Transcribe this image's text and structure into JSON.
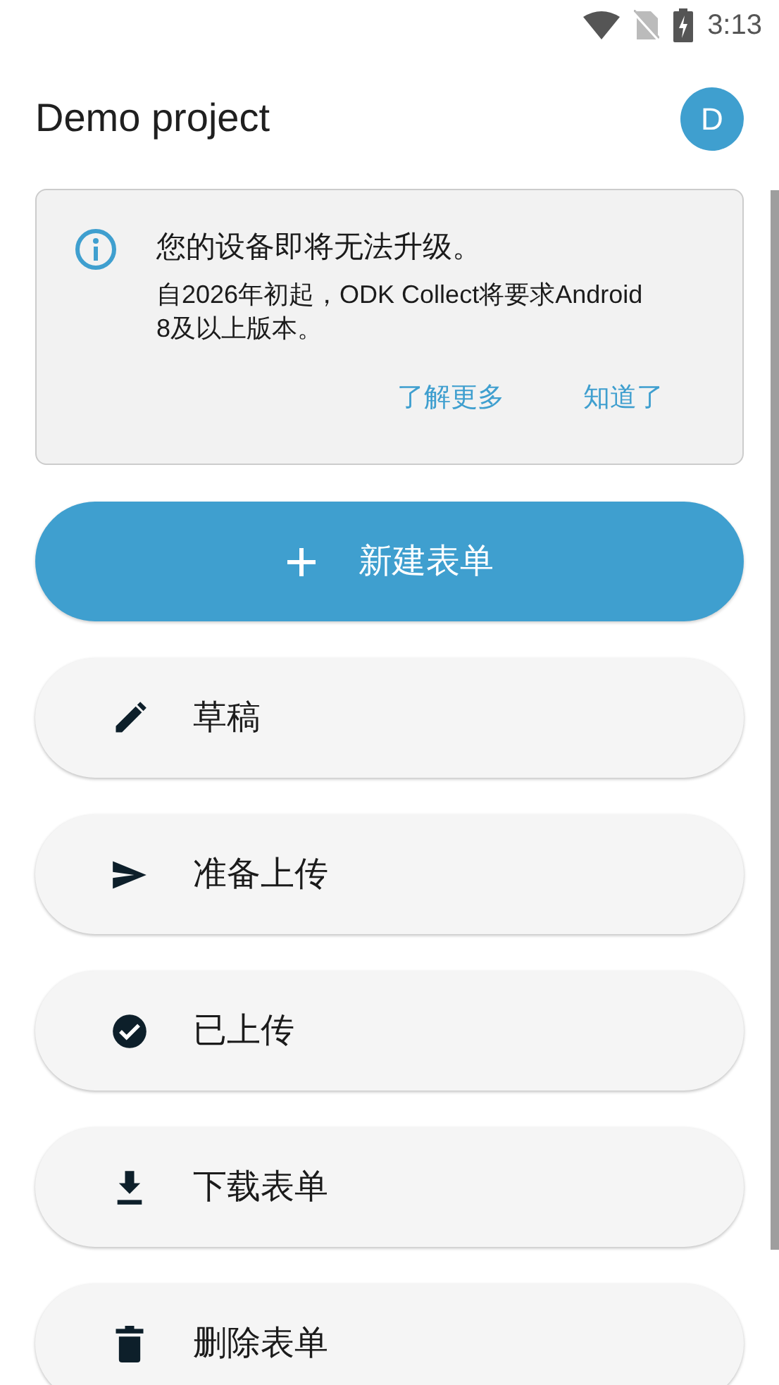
{
  "status_bar": {
    "time": "3:13"
  },
  "header": {
    "title": "Demo project",
    "avatar": "D"
  },
  "banner": {
    "title": "您的设备即将无法升级。",
    "message": "自2026年初起，ODK Collect将要求Android 8及以上版本。",
    "actions": [
      "了解更多",
      "知道了"
    ]
  },
  "primary_button": {
    "label": "新建表单"
  },
  "menu": [
    {
      "kind": "edit",
      "label": "草稿"
    },
    {
      "kind": "send",
      "label": "准备上传"
    },
    {
      "kind": "done",
      "label": "已上传"
    },
    {
      "kind": "download",
      "label": "下载表单"
    },
    {
      "kind": "delete",
      "label": "删除表单"
    }
  ]
}
